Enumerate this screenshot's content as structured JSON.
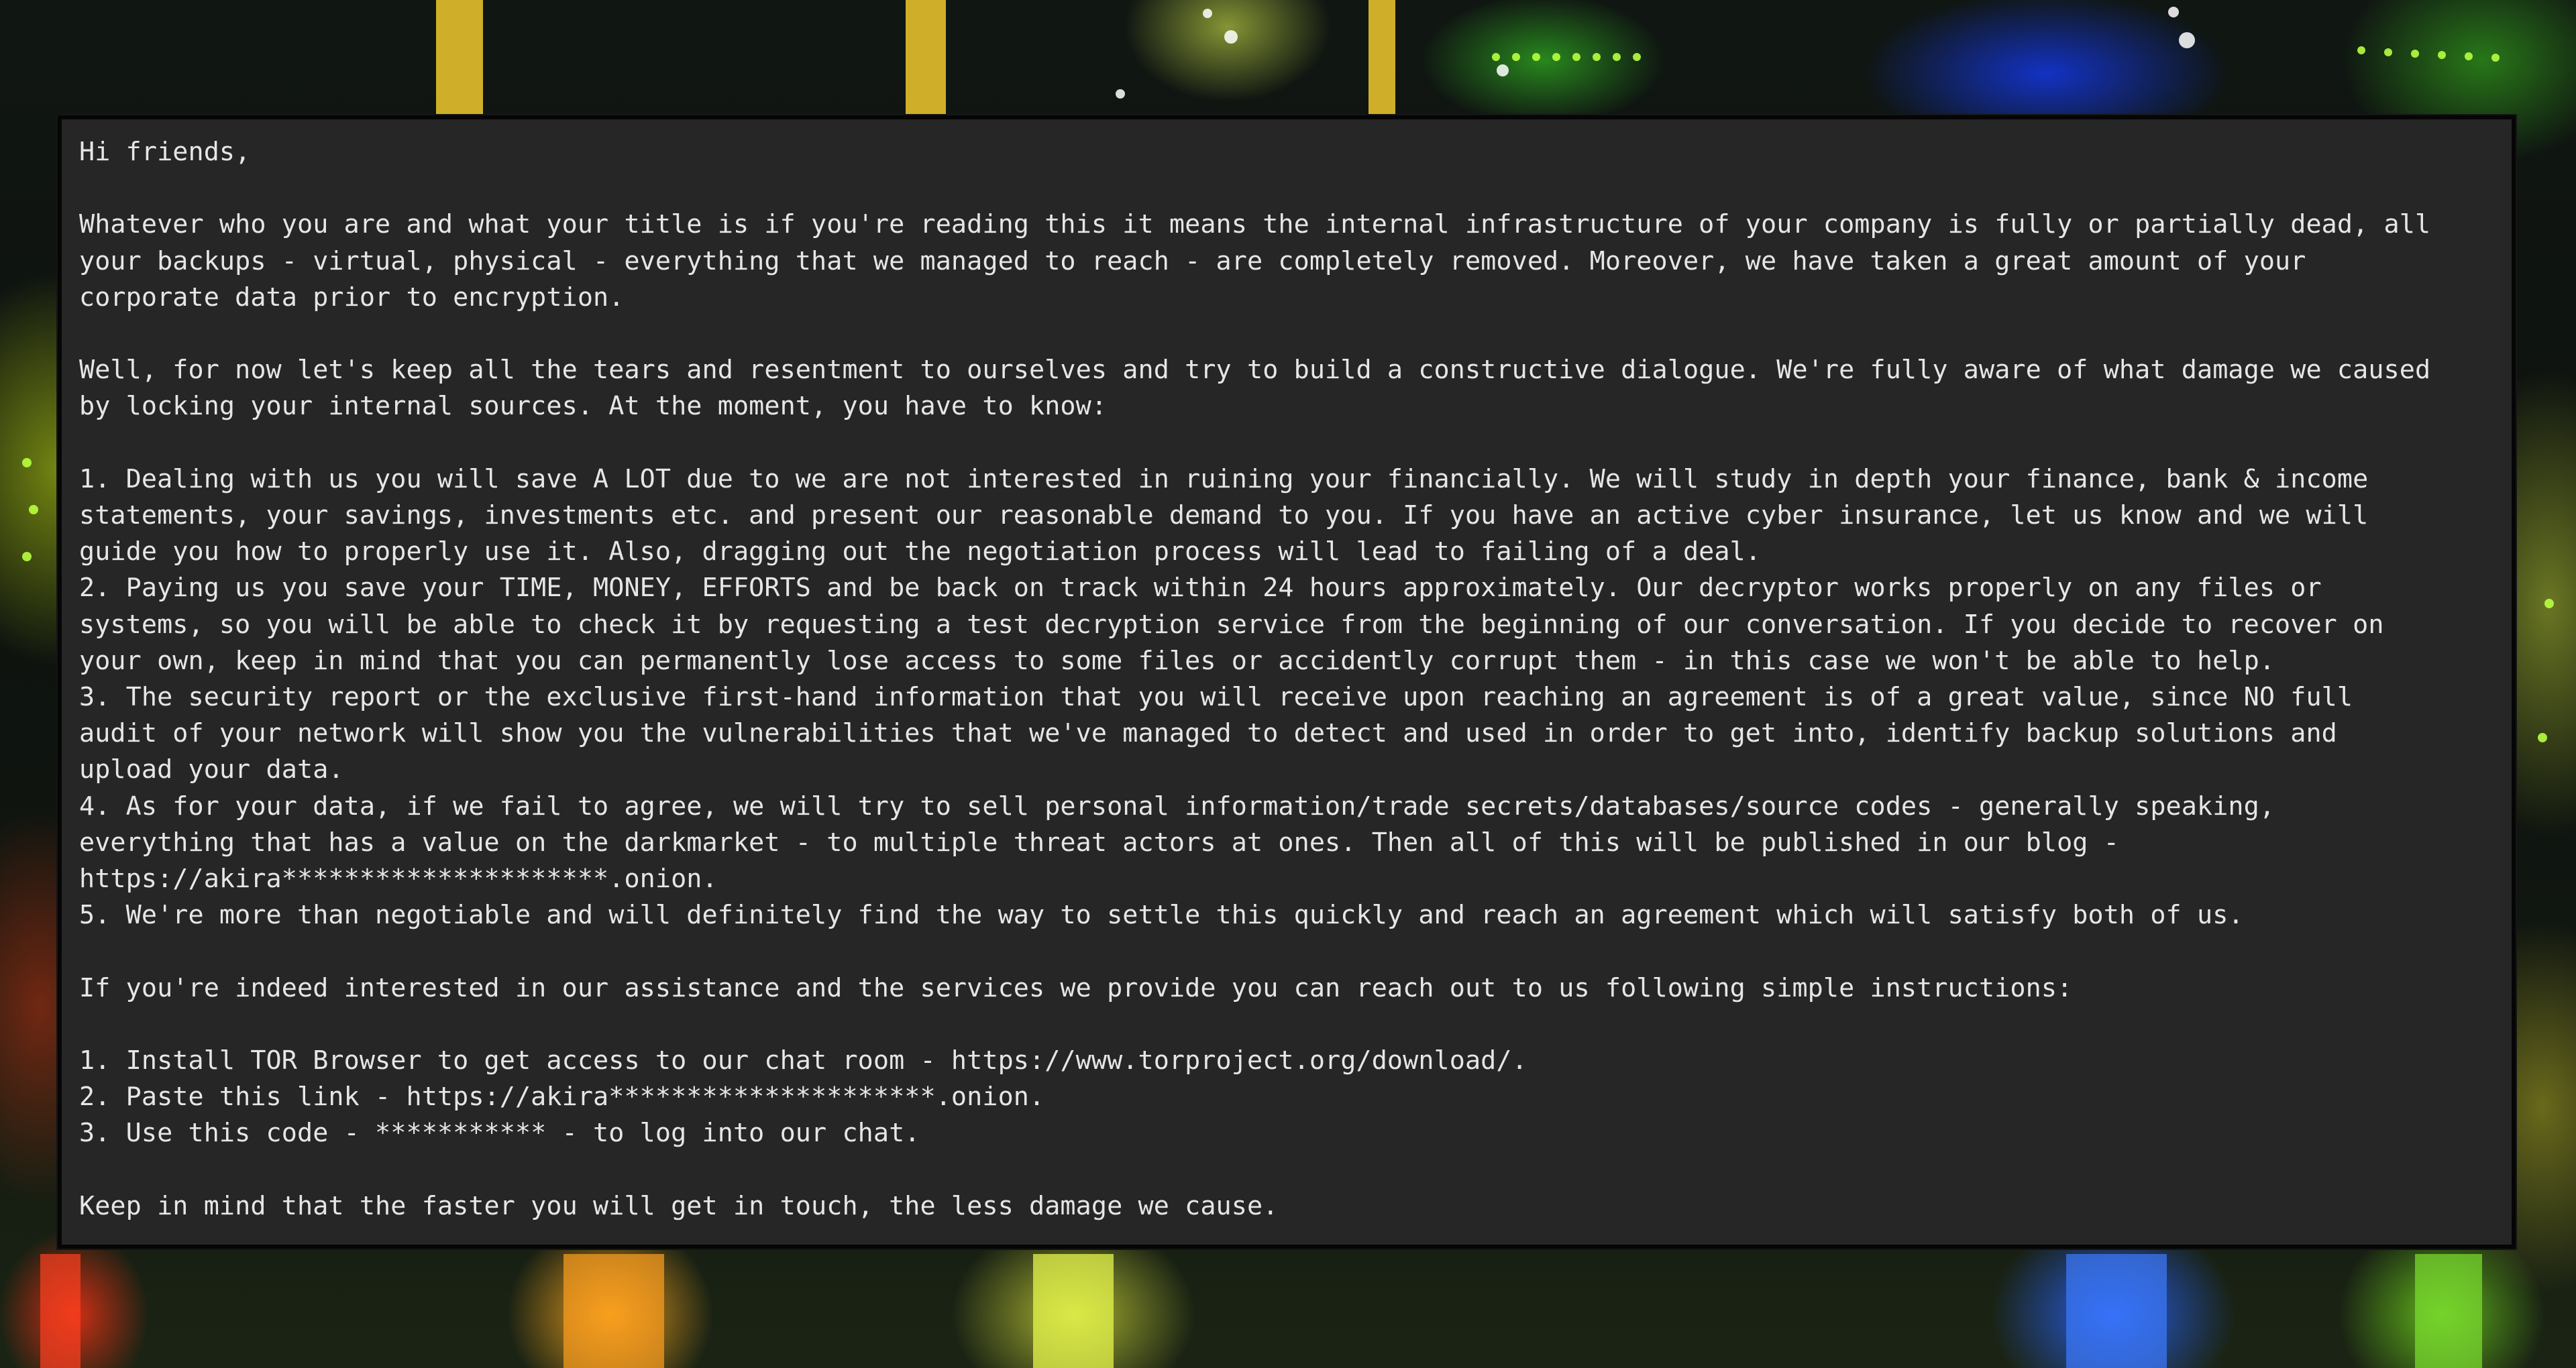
{
  "note": {
    "lines": [
      "Hi friends,",
      "",
      "Whatever who you are and what your title is if you're reading this it means the internal infrastructure of your company is fully or partially dead, all",
      "your backups - virtual, physical - everything that we managed to reach - are completely removed. Moreover, we have taken a great amount of your",
      "corporate data prior to encryption.",
      "",
      "Well, for now let's keep all the tears and resentment to ourselves and try to build a constructive dialogue. We're fully aware of what damage we caused",
      "by locking your internal sources. At the moment, you have to know:",
      "",
      "1. Dealing with us you will save A LOT due to we are not interested in ruining your financially. We will study in depth your finance, bank & income",
      "statements, your savings, investments etc. and present our reasonable demand to you. If you have an active cyber insurance, let us know and we will",
      "guide you how to properly use it. Also, dragging out the negotiation process will lead to failing of a deal.",
      "2. Paying us you save your TIME, MONEY, EFFORTS and be back on track within 24 hours approximately. Our decryptor works properly on any files or",
      "systems, so you will be able to check it by requesting a test decryption service from the beginning of our conversation. If you decide to recover on",
      "your own, keep in mind that you can permanently lose access to some files or accidently corrupt them - in this case we won't be able to help.",
      "3. The security report or the exclusive first-hand information that you will receive upon reaching an agreement is of a great value, since NO full",
      "audit of your network will show you the vulnerabilities that we've managed to detect and used in order to get into, identify backup solutions and",
      "upload your data.",
      "4. As for your data, if we fail to agree, we will try to sell personal information/trade secrets/databases/source codes - generally speaking,",
      "everything that has a value on the darkmarket - to multiple threat actors at ones. Then all of this will be published in our blog -",
      "https://akira*********************.onion.",
      "5. We're more than negotiable and will definitely find the way to settle this quickly and reach an agreement which will satisfy both of us.",
      "",
      "If you're indeed interested in our assistance and the services we provide you can reach out to us following simple instructions:",
      "",
      "1. Install TOR Browser to get access to our chat room - https://www.torproject.org/download/.",
      "2. Paste this link - https://akira*********************.onion.",
      "3. Use this code - *********** - to log into our chat.",
      "",
      "Keep in mind that the faster you will get in touch, the less damage we cause."
    ]
  }
}
